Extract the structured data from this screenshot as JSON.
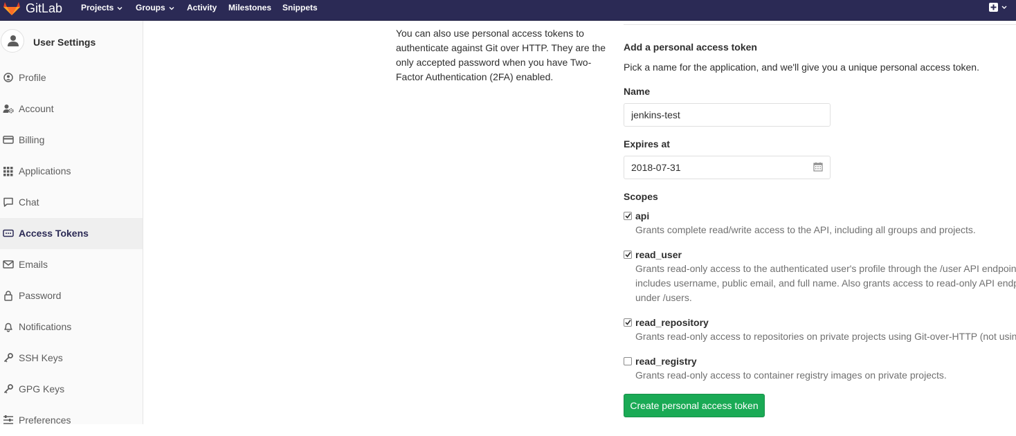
{
  "topbar": {
    "brand": "GitLab",
    "nav": [
      {
        "label": "Projects",
        "dropdown": true
      },
      {
        "label": "Groups",
        "dropdown": true
      },
      {
        "label": "Activity",
        "dropdown": false
      },
      {
        "label": "Milestones",
        "dropdown": false
      },
      {
        "label": "Snippets",
        "dropdown": false
      }
    ],
    "colors": {
      "bar": "#2b2a55"
    }
  },
  "sidebar": {
    "title": "User Settings",
    "items": [
      {
        "label": "Profile",
        "icon": "profile-icon",
        "active": false
      },
      {
        "label": "Account",
        "icon": "account-gear-icon",
        "active": false
      },
      {
        "label": "Billing",
        "icon": "credit-card-icon",
        "active": false
      },
      {
        "label": "Applications",
        "icon": "grid-icon",
        "active": false
      },
      {
        "label": "Chat",
        "icon": "comment-icon",
        "active": false
      },
      {
        "label": "Access Tokens",
        "icon": "token-icon",
        "active": true
      },
      {
        "label": "Emails",
        "icon": "envelope-icon",
        "active": false
      },
      {
        "label": "Password",
        "icon": "lock-icon",
        "active": false
      },
      {
        "label": "Notifications",
        "icon": "bell-icon",
        "active": false
      },
      {
        "label": "SSH Keys",
        "icon": "key-icon",
        "active": false
      },
      {
        "label": "GPG Keys",
        "icon": "key-icon",
        "active": false
      },
      {
        "label": "Preferences",
        "icon": "sliders-icon",
        "active": false
      }
    ]
  },
  "intro_lines": [
    "You can also use personal access tokens to",
    "authenticate against Git over HTTP. They are the",
    "only accepted password when you have Two-",
    "Factor Authentication (2FA) enabled."
  ],
  "form": {
    "heading": "Add a personal access token",
    "help": "Pick a name for the application, and we'll give you a unique personal access token.",
    "name_label": "Name",
    "name_value": "jenkins-test",
    "expires_label": "Expires at",
    "expires_value": "2018-07-31",
    "scopes_label": "Scopes",
    "submit_label": "Create personal access token",
    "submit_color": "#1aaa55"
  },
  "scopes": [
    {
      "name": "api",
      "checked": true,
      "desc": [
        "Grants complete read/write access to the API, including all groups and projects."
      ]
    },
    {
      "name": "read_user",
      "checked": true,
      "desc": [
        "Grants read-only access to the authenticated user's profile through the /user API endpoint, which",
        "includes username, public email, and full name. Also grants access to read-only API endpoints",
        "under /users."
      ]
    },
    {
      "name": "read_repository",
      "checked": true,
      "desc": [
        "Grants read-only access to repositories on private projects using Git-over-HTTP (not using the API)."
      ]
    },
    {
      "name": "read_registry",
      "checked": false,
      "desc": [
        "Grants read-only access to container registry images on private projects."
      ]
    }
  ]
}
